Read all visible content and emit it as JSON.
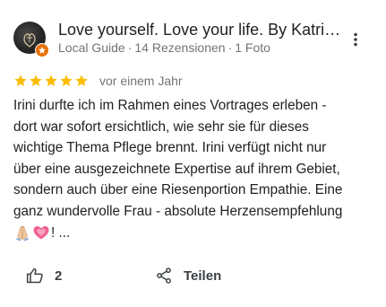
{
  "reviewer": {
    "name": "Love yourself. Love your life. By Katrin...",
    "role": "Local Guide",
    "reviews": "14 Rezensionen",
    "photos": "1 Foto",
    "separator": "·"
  },
  "rating": {
    "stars": 5,
    "max_stars": 5,
    "star_color": "#fbbc04",
    "date": "vor einem Jahr"
  },
  "review": {
    "lines": [
      "Irini durfte ich im Rahmen eines Vortrages erleben -",
      "dort war sofort ersichtlich, wie sehr sie für dieses",
      "wichtige Thema Pflege brennt. Irini verfügt nicht nur",
      "über eine ausgezeichnete Expertise auf ihrem Gebiet,",
      "sondern auch über eine Riesenportion Empathie. Eine",
      "ganz wundervolle Frau - absolute Herzensempfehlung"
    ],
    "emojis": [
      "folded-hands-emoji",
      "growing-heart-emoji"
    ],
    "tail": "! ..."
  },
  "actions": {
    "like_count": "2",
    "share_label": "Teilen"
  },
  "colors": {
    "text": "#202124",
    "secondary": "#70757a",
    "badge": "#e8710a"
  }
}
